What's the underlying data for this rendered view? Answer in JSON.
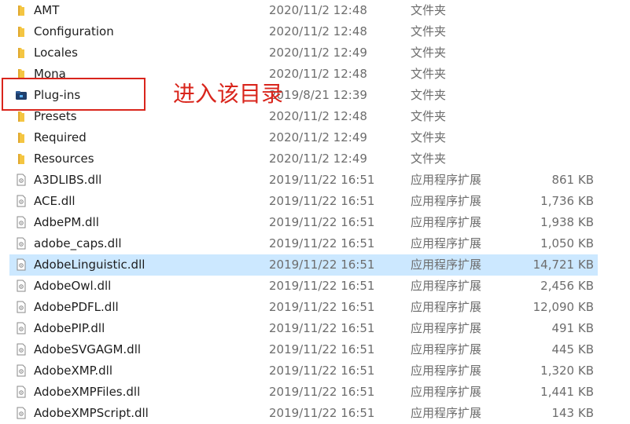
{
  "colors": {
    "folder": "#f4c542",
    "selected_row": "#cce8ff",
    "annotation": "#d9251c"
  },
  "annotation": "进入该目录",
  "rows": [
    {
      "name": "AMT",
      "date": "2020/11/2 12:48",
      "type": "文件夹",
      "size": "",
      "icon": "folder-icon"
    },
    {
      "name": "Configuration",
      "date": "2020/11/2 12:48",
      "type": "文件夹",
      "size": "",
      "icon": "folder-icon"
    },
    {
      "name": "Locales",
      "date": "2020/11/2 12:49",
      "type": "文件夹",
      "size": "",
      "icon": "folder-icon"
    },
    {
      "name": "Mona",
      "date": "2020/11/2 12:48",
      "type": "文件夹",
      "size": "",
      "icon": "folder-icon"
    },
    {
      "name": "Plug-ins",
      "date": "2019/8/21 12:39",
      "type": "文件夹",
      "size": "",
      "icon": "folder-plugin-icon"
    },
    {
      "name": "Presets",
      "date": "2020/11/2 12:48",
      "type": "文件夹",
      "size": "",
      "icon": "folder-icon"
    },
    {
      "name": "Required",
      "date": "2020/11/2 12:49",
      "type": "文件夹",
      "size": "",
      "icon": "folder-icon"
    },
    {
      "name": "Resources",
      "date": "2020/11/2 12:49",
      "type": "文件夹",
      "size": "",
      "icon": "folder-icon"
    },
    {
      "name": "A3DLIBS.dll",
      "date": "2019/11/22 16:51",
      "type": "应用程序扩展",
      "size": "861 KB",
      "icon": "dll-file-icon"
    },
    {
      "name": "ACE.dll",
      "date": "2019/11/22 16:51",
      "type": "应用程序扩展",
      "size": "1,736 KB",
      "icon": "dll-file-icon"
    },
    {
      "name": "AdbePM.dll",
      "date": "2019/11/22 16:51",
      "type": "应用程序扩展",
      "size": "1,938 KB",
      "icon": "dll-file-icon"
    },
    {
      "name": "adobe_caps.dll",
      "date": "2019/11/22 16:51",
      "type": "应用程序扩展",
      "size": "1,050 KB",
      "icon": "dll-file-icon"
    },
    {
      "name": "AdobeLinguistic.dll",
      "date": "2019/11/22 16:51",
      "type": "应用程序扩展",
      "size": "14,721 KB",
      "icon": "dll-file-icon"
    },
    {
      "name": "AdobeOwl.dll",
      "date": "2019/11/22 16:51",
      "type": "应用程序扩展",
      "size": "2,456 KB",
      "icon": "dll-file-icon"
    },
    {
      "name": "AdobePDFL.dll",
      "date": "2019/11/22 16:51",
      "type": "应用程序扩展",
      "size": "12,090 KB",
      "icon": "dll-file-icon"
    },
    {
      "name": "AdobePIP.dll",
      "date": "2019/11/22 16:51",
      "type": "应用程序扩展",
      "size": "491 KB",
      "icon": "dll-file-icon"
    },
    {
      "name": "AdobeSVGAGM.dll",
      "date": "2019/11/22 16:51",
      "type": "应用程序扩展",
      "size": "445 KB",
      "icon": "dll-file-icon"
    },
    {
      "name": "AdobeXMP.dll",
      "date": "2019/11/22 16:51",
      "type": "应用程序扩展",
      "size": "1,320 KB",
      "icon": "dll-file-icon"
    },
    {
      "name": "AdobeXMPFiles.dll",
      "date": "2019/11/22 16:51",
      "type": "应用程序扩展",
      "size": "1,441 KB",
      "icon": "dll-file-icon"
    },
    {
      "name": "AdobeXMPScript.dll",
      "date": "2019/11/22 16:51",
      "type": "应用程序扩展",
      "size": "143 KB",
      "icon": "dll-file-icon"
    }
  ],
  "selected_row": 12
}
